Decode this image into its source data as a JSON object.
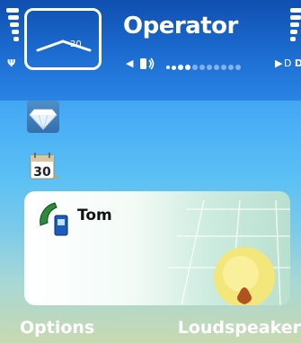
{
  "status": {
    "operator": "Operator",
    "clock_digit": "20",
    "signal_label": "Ψ",
    "charger_label": "D"
  },
  "call": {
    "contact_name": "Tom"
  },
  "calendar": {
    "day": "30"
  },
  "softkeys": {
    "left": "Options",
    "right": "Loudspeaker"
  }
}
